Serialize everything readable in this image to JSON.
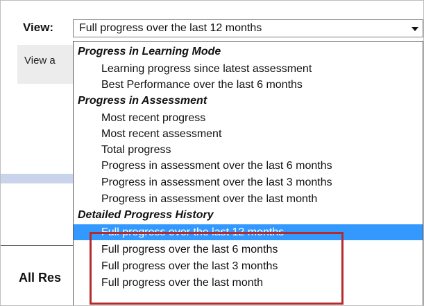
{
  "view": {
    "label": "View:",
    "selected_value": "Full progress over the last 12 months"
  },
  "background": {
    "panel_text": "View a",
    "all_results": "All Res"
  },
  "dropdown": {
    "groups": [
      {
        "header": "Progress in Learning Mode",
        "options": [
          "Learning progress since latest assessment",
          "Best Performance over the last 6 months"
        ]
      },
      {
        "header": "Progress in Assessment",
        "options": [
          "Most recent progress",
          "Most recent assessment",
          "Total progress",
          "Progress in assessment over the last 6 months",
          "Progress in assessment over the last 3 months",
          "Progress in assessment over the last month"
        ]
      },
      {
        "header": "Detailed Progress History",
        "options": [
          "Full progress over the last 12 months",
          "Full progress over the last 6 months",
          "Full progress over the last 3 months",
          "Full progress over the last month"
        ]
      }
    ]
  },
  "colors": {
    "selected_bg": "#3399ff",
    "highlight_border": "#b52a2a"
  }
}
